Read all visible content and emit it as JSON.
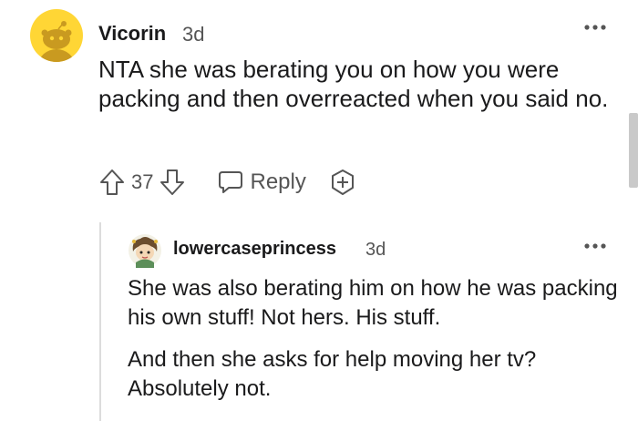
{
  "comment": {
    "author": "Vicorin",
    "time": "3d",
    "body": "NTA she was berating you on how you were packing and then overreacted when you said no.",
    "votes": "37",
    "reply_label": "Reply",
    "avatar_color": "#ffd635",
    "icons": [
      "upvote-icon",
      "downvote-icon",
      "reply-icon",
      "award-icon",
      "more-options-icon"
    ]
  },
  "reply": {
    "author": "lowercaseprincess",
    "time": "3d",
    "paragraphs": [
      "She was also berating him on how he was packing his own stuff! Not hers. His stuff.",
      "And then she asks for help moving her tv? Absolutely not."
    ]
  }
}
